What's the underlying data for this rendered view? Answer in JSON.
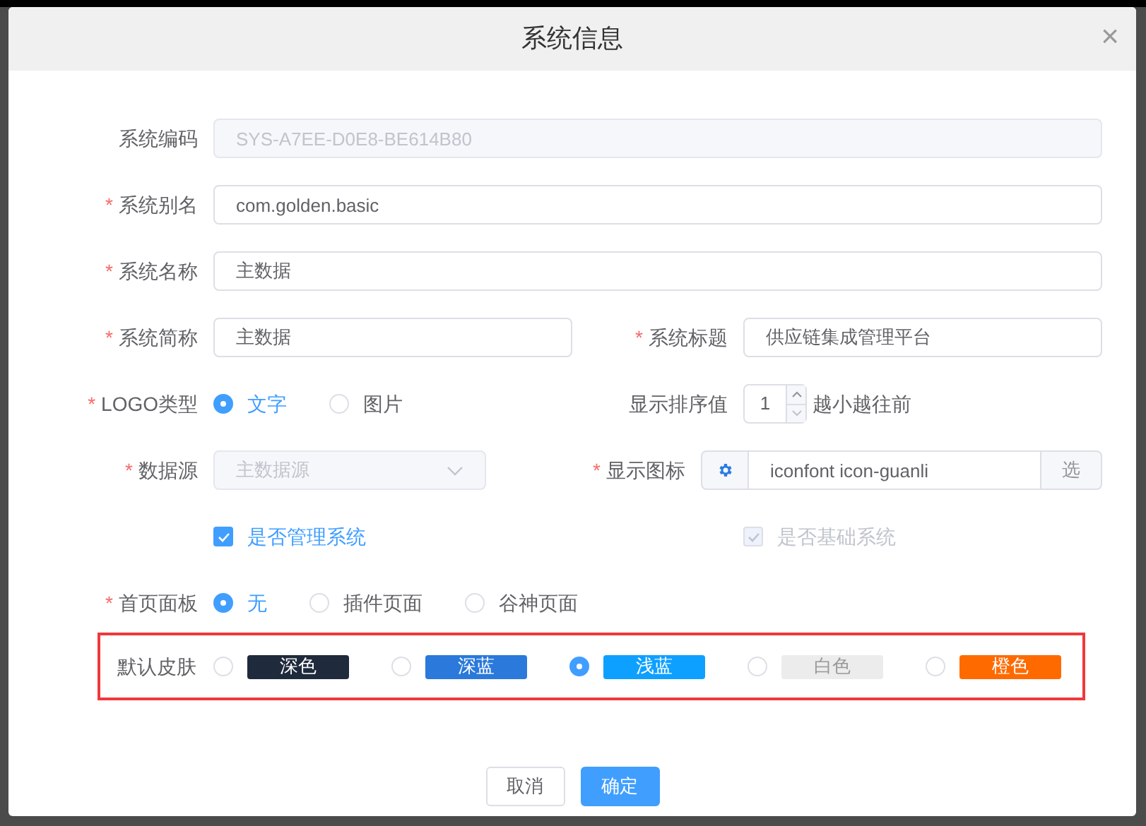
{
  "dialog": {
    "title": "系统信息",
    "close": "×"
  },
  "rows": [
    [
      {
        "kind": "text",
        "label": "系统编码",
        "value": "SYS-A7EE-D0E8-BE614B80",
        "disabled": true
      }
    ],
    [
      {
        "kind": "text",
        "required_mark": "*",
        "label": "系统别名",
        "value": "com.golden.basic",
        "disabled": false
      }
    ],
    [
      {
        "kind": "text",
        "required_mark": "*",
        "label": "系统名称",
        "value": "主数据",
        "disabled": false
      }
    ],
    [
      {
        "kind": "text",
        "required_mark": "*",
        "label": "系统简称",
        "value": "主数据",
        "disabled": false
      },
      {
        "kind": "text",
        "required_mark": "*",
        "label": "系统标题",
        "value": "供应链集成管理平台",
        "disabled": false
      }
    ],
    [
      {
        "kind": "radio",
        "required_mark": "*",
        "label": "LOGO类型",
        "options": [
          {
            "label": "文字",
            "selected": true
          },
          {
            "label": "图片",
            "selected": false
          }
        ]
      },
      {
        "kind": "number",
        "label": "显示排序值",
        "value": "1",
        "hint": "越小越往前"
      }
    ],
    [
      {
        "kind": "select",
        "required_mark": "*",
        "label": "数据源",
        "value": "主数据源",
        "disabled": true
      },
      {
        "kind": "icon_input",
        "required_mark": "*",
        "label": "显示图标",
        "value": "iconfont icon-guanli",
        "button": "选"
      }
    ],
    [
      {
        "kind": "checkbox",
        "text": "是否管理系统",
        "checked": true,
        "disabled": false
      },
      {
        "kind": "checkbox",
        "text": "是否基础系统",
        "checked": true,
        "disabled": true
      }
    ],
    [
      {
        "kind": "radio",
        "required_mark": "*",
        "label": "首页面板",
        "options": [
          {
            "label": "无",
            "selected": true
          },
          {
            "label": "插件页面",
            "selected": false
          },
          {
            "label": "谷神页面",
            "selected": false
          }
        ]
      }
    ]
  ],
  "skins": {
    "label": "默认皮肤",
    "options": [
      {
        "label": "深色",
        "color": "#1f2a3c",
        "selected": false
      },
      {
        "label": "深蓝",
        "color": "#2a79db",
        "selected": false
      },
      {
        "label": "浅蓝",
        "color": "#0ea0ff",
        "selected": true
      },
      {
        "label": "白色",
        "color": "#ececec",
        "selected": false
      },
      {
        "label": "橙色",
        "color": "#ff6a00",
        "selected": false
      }
    ]
  },
  "buttons": [
    {
      "label": "取消",
      "kind": "default"
    },
    {
      "label": "确定",
      "kind": "primary"
    }
  ]
}
